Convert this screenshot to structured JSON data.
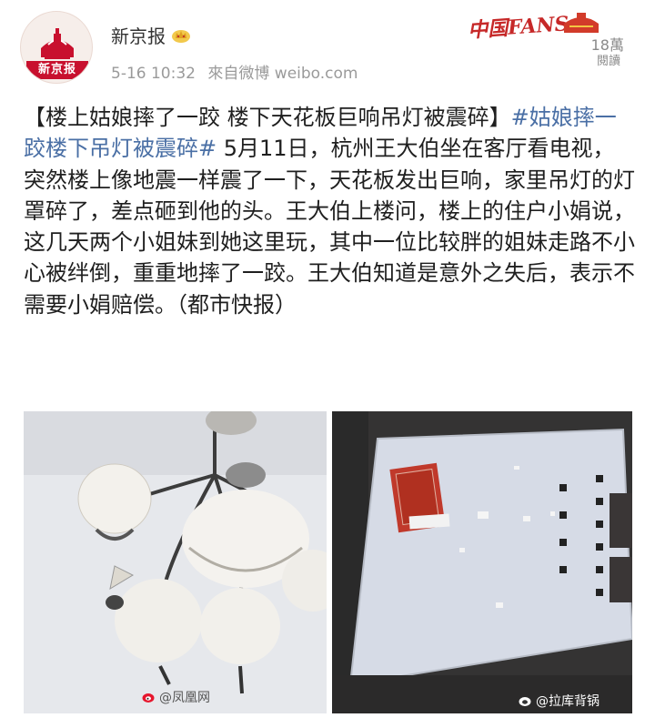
{
  "account": {
    "name": "新京报",
    "avatar_text": "新京报",
    "timestamp": "5-16 10:32",
    "source": "來自微博 weibo.com"
  },
  "badge": {
    "brand": "中国FANS",
    "reads_count": "18萬",
    "reads_label": "閱讀"
  },
  "post": {
    "headline": "【楼上姑娘摔了一跤 楼下天花板巨响吊灯被震碎】",
    "hashtag": "#姑娘摔一跤楼下吊灯被震碎#",
    "body": " 5月11日，杭州王大伯坐在客厅看电视，突然楼上像地震一样震了一下，天花板发出巨响，家里吊灯的灯罩碎了，差点砸到他的头。王大伯上楼问，楼上的住户小娟说，这几天两个小姐妹到她这里玩，其中一位比较胖的姐妹走路不小心被绊倒，重重地摔了一跤。王大伯知道是意外之失后，表示不需要小娟赔偿。（都市快报）"
  },
  "images": {
    "left_watermark": "@凤凰网",
    "right_watermark": "@拉库背锅"
  },
  "colors": {
    "hashtag": "#4a6fa5",
    "brand_red": "#c8102e",
    "meta_gray": "#9a9a9a"
  }
}
